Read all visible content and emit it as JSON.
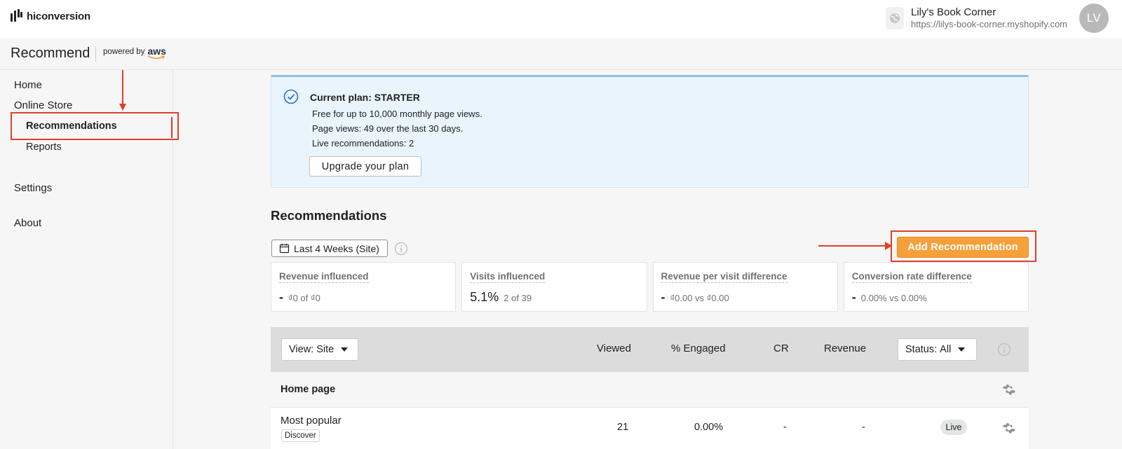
{
  "header": {
    "brand": "hiconversion",
    "store_name": "Lily's Book Corner",
    "store_url": "https://lilys-book-corner.myshopify.com",
    "avatar_initials": "LV"
  },
  "subheader": {
    "app_title": "Recommend",
    "powered_by": "powered by",
    "aws_label": "aws"
  },
  "sidebar": {
    "items": [
      {
        "label": "Home"
      },
      {
        "label": "Online Store"
      },
      {
        "label": "Recommendations"
      },
      {
        "label": "Reports"
      },
      {
        "label": "Settings"
      },
      {
        "label": "About"
      }
    ]
  },
  "plan": {
    "title": "Current plan: STARTER",
    "line1": "Free for up to 10,000 monthly page views.",
    "line2": "Page views: 49 over the last 30 days.",
    "line3": "Live recommendations: 2",
    "upgrade_label": "Upgrade your plan"
  },
  "recommendations": {
    "title": "Recommendations",
    "date_range": "Last 4 Weeks (Site)",
    "add_label": "Add Recommendation"
  },
  "metrics": [
    {
      "label": "Revenue influenced",
      "value": "-",
      "detail": "₫0 of ₫0"
    },
    {
      "label": "Visits influenced",
      "value": "5.1%",
      "detail": "2 of 39"
    },
    {
      "label": "Revenue per visit difference",
      "value": "-",
      "detail": "₫0.00 vs ₫0.00"
    },
    {
      "label": "Conversion rate difference",
      "value": "-",
      "detail": "0.00% vs 0.00%"
    }
  ],
  "table": {
    "view_label": "View:",
    "view_value": "Site",
    "columns": [
      "Viewed",
      "% Engaged",
      "CR",
      "Revenue"
    ],
    "status_label": "Status:",
    "status_value": "All",
    "group": "Home page",
    "rows": [
      {
        "name": "Most popular",
        "tag": "Discover",
        "viewed": "21",
        "engaged": "0.00%",
        "cr": "-",
        "revenue": "-",
        "status": "Live"
      }
    ]
  },
  "colors": {
    "accent_orange": "#f6a03a",
    "annotation_red": "#e0402a",
    "plan_blue": "#eaf4fc"
  }
}
